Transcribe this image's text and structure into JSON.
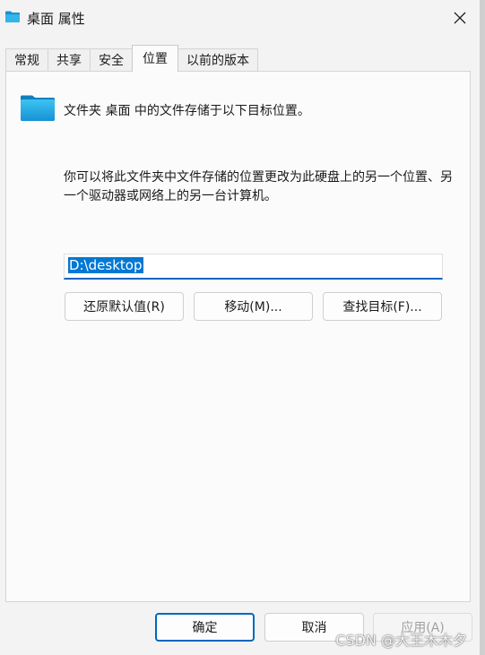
{
  "window": {
    "title": "桌面 属性",
    "close_icon": "close-icon"
  },
  "tabs": [
    {
      "label": "常规",
      "active": false
    },
    {
      "label": "共享",
      "active": false
    },
    {
      "label": "安全",
      "active": false
    },
    {
      "label": "位置",
      "active": true
    },
    {
      "label": "以前的版本",
      "active": false
    }
  ],
  "location": {
    "description_line": "文件夹 桌面 中的文件存储于以下目标位置。",
    "explanation": "你可以将此文件夹中文件存储的位置更改为此硬盘上的另一个位置、另一个驱动器或网络上的另一台计算机。",
    "path_value": "D:\\desktop",
    "restore_default_label": "还原默认值(R)",
    "move_label": "移动(M)...",
    "find_target_label": "查找目标(F)..."
  },
  "footer": {
    "ok_label": "确定",
    "cancel_label": "取消",
    "apply_label": "应用(A)"
  },
  "watermark": "CSDN @大王木木夕",
  "colors": {
    "accent": "#0067c0",
    "selection": "#0078d4",
    "folder": "#1aa7e0"
  }
}
